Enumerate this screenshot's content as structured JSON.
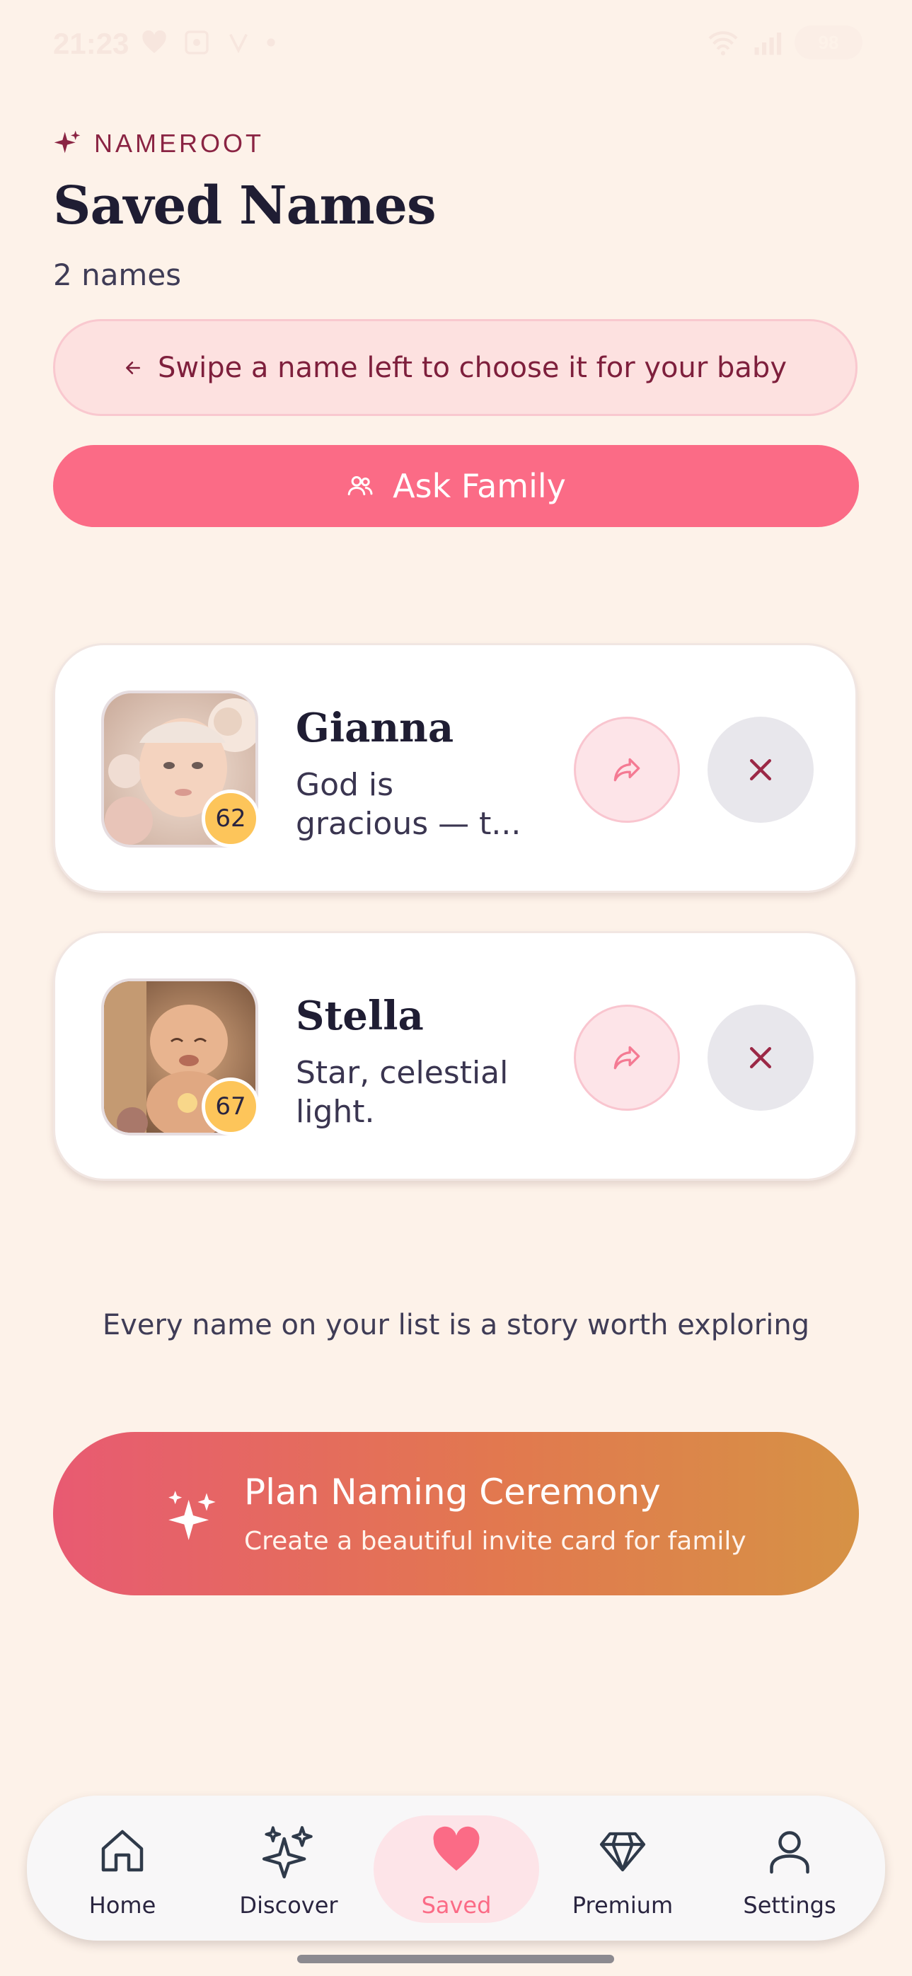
{
  "status": {
    "time": "21:23",
    "battery": "98"
  },
  "brand": {
    "name": "NAMEROOT"
  },
  "page": {
    "title": "Saved Names",
    "count": "2 names"
  },
  "hint": {
    "text": "Swipe a name left to choose it for your baby"
  },
  "ask_family": {
    "label": "Ask Family"
  },
  "saved_names": [
    {
      "name": "Gianna",
      "meaning": "God is gracious — t...",
      "score": "62"
    },
    {
      "name": "Stella",
      "meaning": "Star, celestial light.",
      "score": "67"
    }
  ],
  "story_text": "Every name on your list is a story worth exploring",
  "ceremony": {
    "title": "Plan Naming Ceremony",
    "subtitle": "Create a beautiful invite card for family"
  },
  "nav": {
    "items": [
      {
        "label": "Home",
        "icon": "home-icon"
      },
      {
        "label": "Discover",
        "icon": "sparkles-icon"
      },
      {
        "label": "Saved",
        "icon": "heart-icon",
        "active": true
      },
      {
        "label": "Premium",
        "icon": "diamond-icon"
      },
      {
        "label": "Settings",
        "icon": "person-icon"
      }
    ]
  },
  "colors": {
    "accent": "#fb6b86",
    "brand": "#8a2443",
    "background": "#fdf2e9",
    "score_badge": "#fdc55a"
  }
}
